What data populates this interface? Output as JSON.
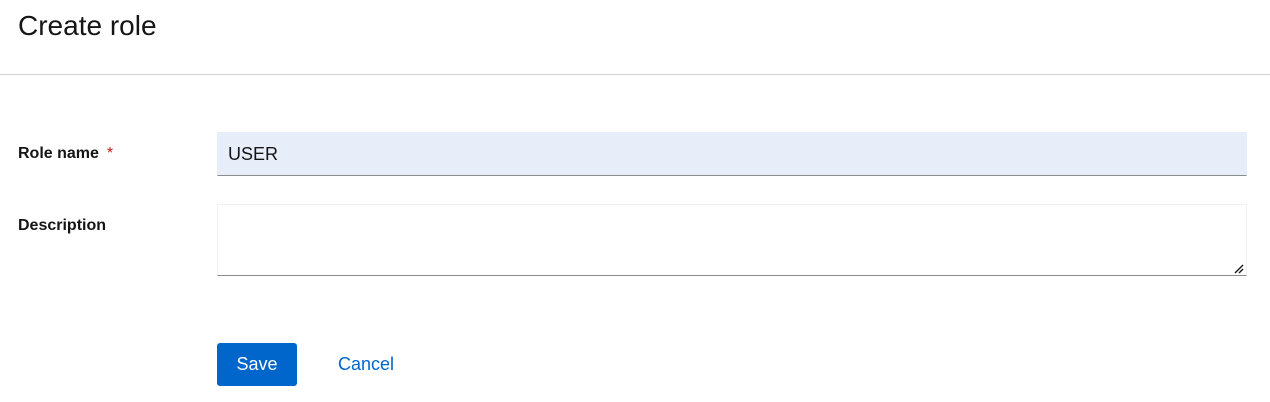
{
  "page": {
    "title": "Create role"
  },
  "form": {
    "role_name": {
      "label": "Role name",
      "required_marker": "*",
      "value": "USER"
    },
    "description": {
      "label": "Description",
      "value": ""
    }
  },
  "actions": {
    "save_label": "Save",
    "cancel_label": "Cancel"
  },
  "colors": {
    "primary": "#0066cc",
    "required": "#c9190b",
    "input_filled_bg": "#e7eefa"
  }
}
